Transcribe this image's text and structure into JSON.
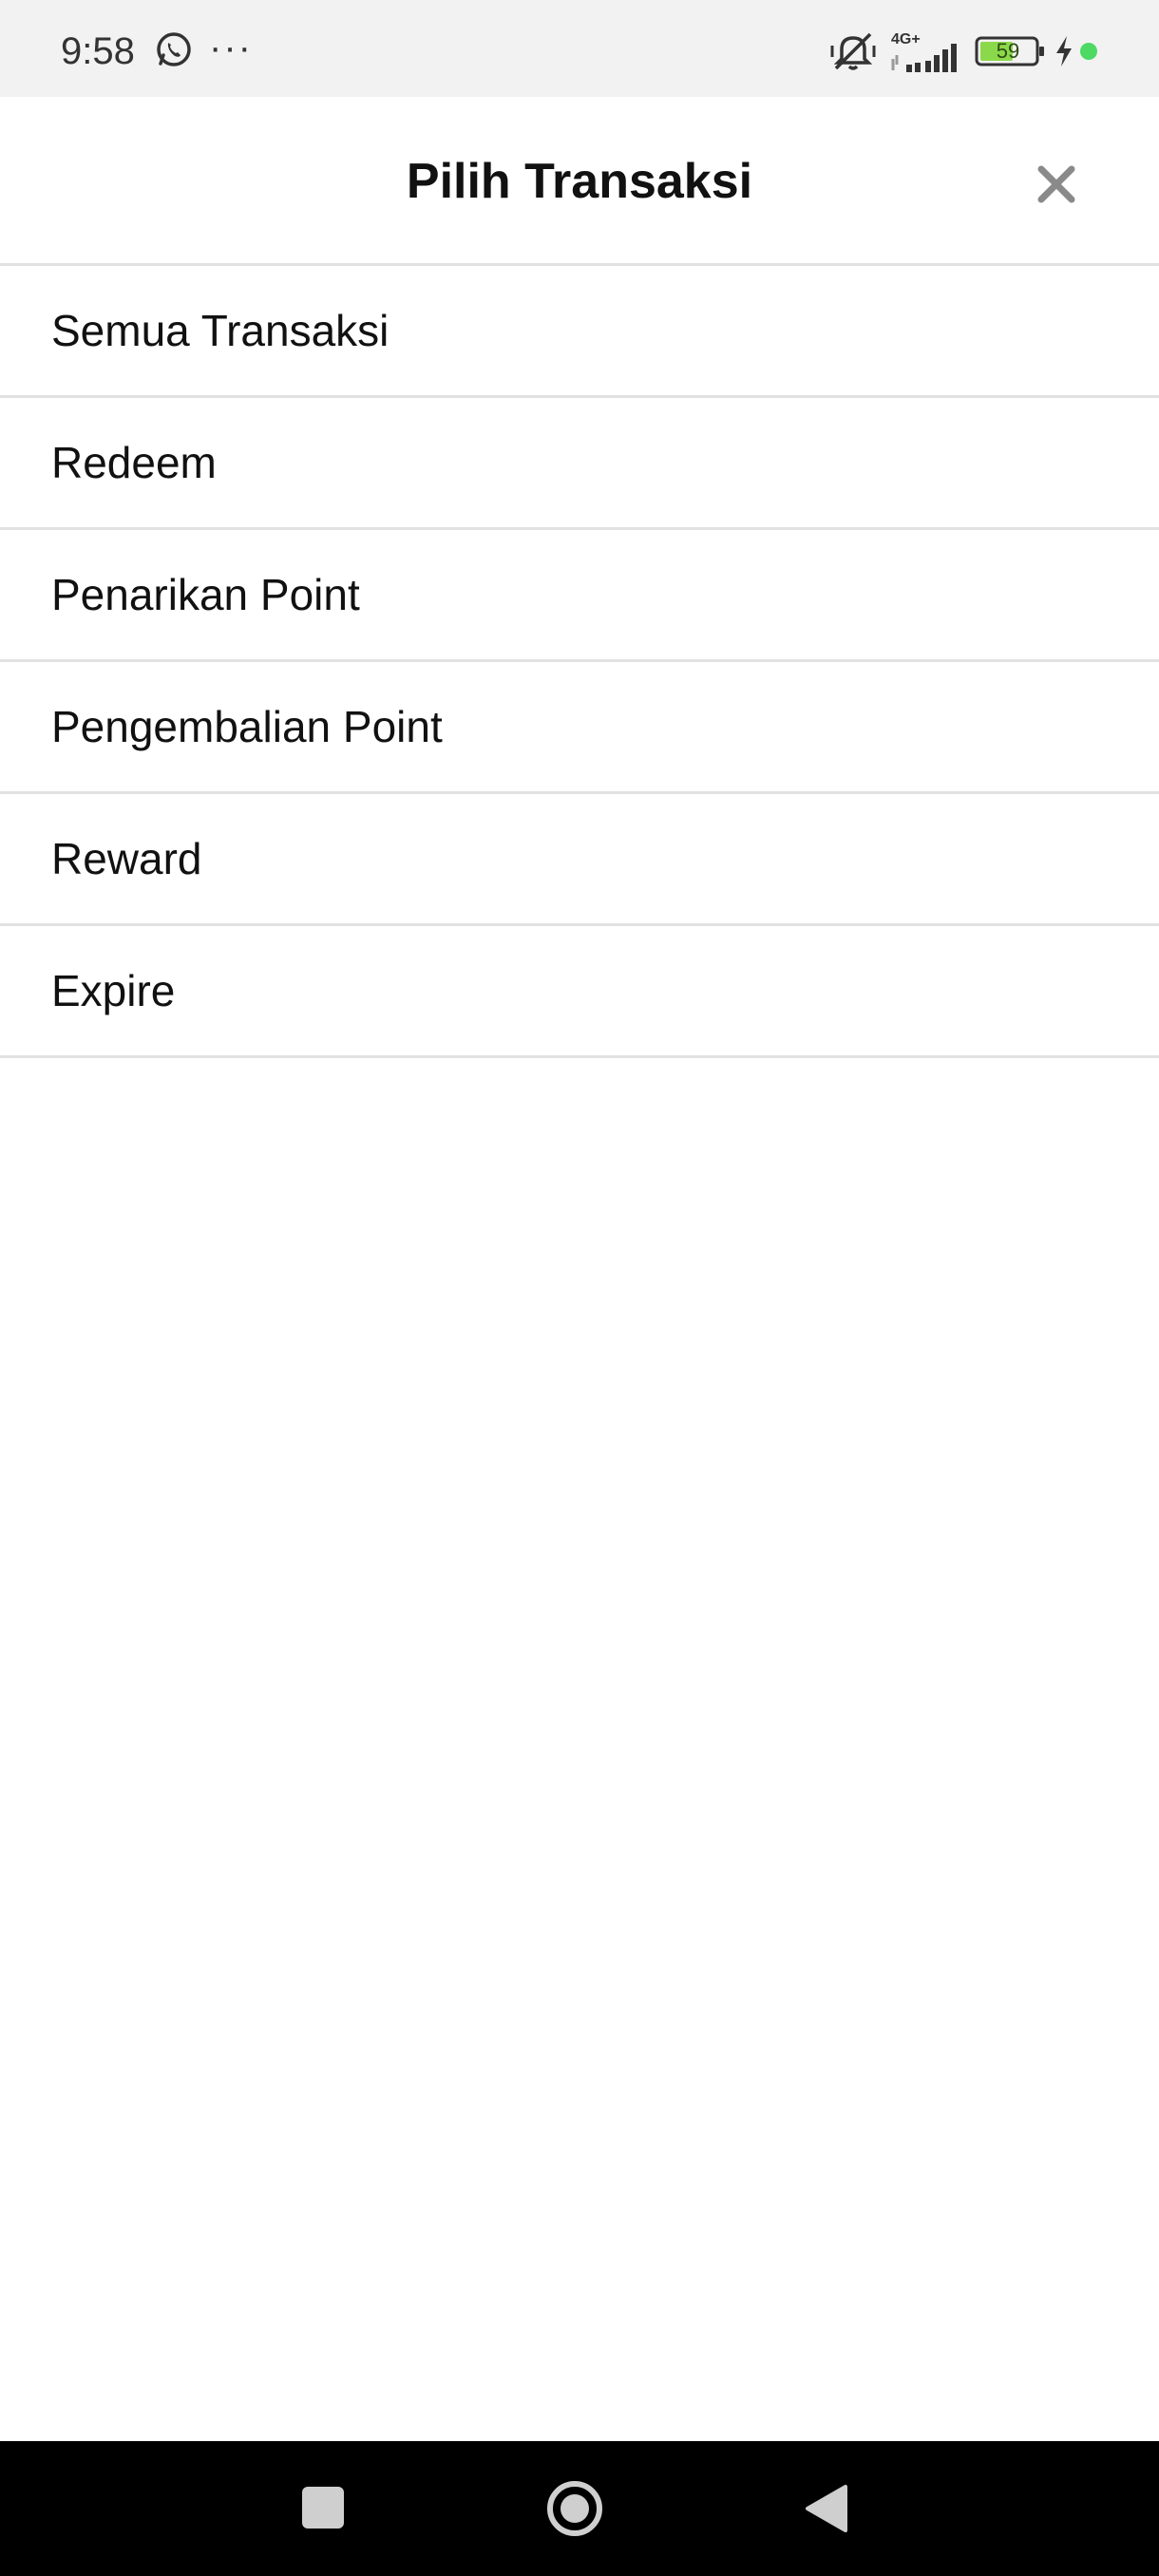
{
  "status_bar": {
    "time": "9:58",
    "more": "···",
    "network": "4G+",
    "battery_level": "59",
    "icons": [
      "whatsapp-icon",
      "mute-icon",
      "signal-icon",
      "battery-icon",
      "charging-icon",
      "dot-icon"
    ],
    "dot_color": "#4cd964",
    "battery_color": "#8bd94a"
  },
  "header": {
    "title": "Pilih Transaksi",
    "close_icon": "close-icon"
  },
  "options": [
    {
      "label": "Semua Transaksi"
    },
    {
      "label": "Redeem"
    },
    {
      "label": "Penarikan Point"
    },
    {
      "label": "Pengembalian Point"
    },
    {
      "label": "Reward"
    },
    {
      "label": "Expire"
    }
  ],
  "nav_bar": {
    "icons": [
      "recent-apps-icon",
      "home-icon",
      "back-icon"
    ]
  },
  "colors": {
    "divider": "#e2e2e2",
    "status_bar_bg": "#f2f2f2",
    "nav_bar_bg": "#000000"
  }
}
